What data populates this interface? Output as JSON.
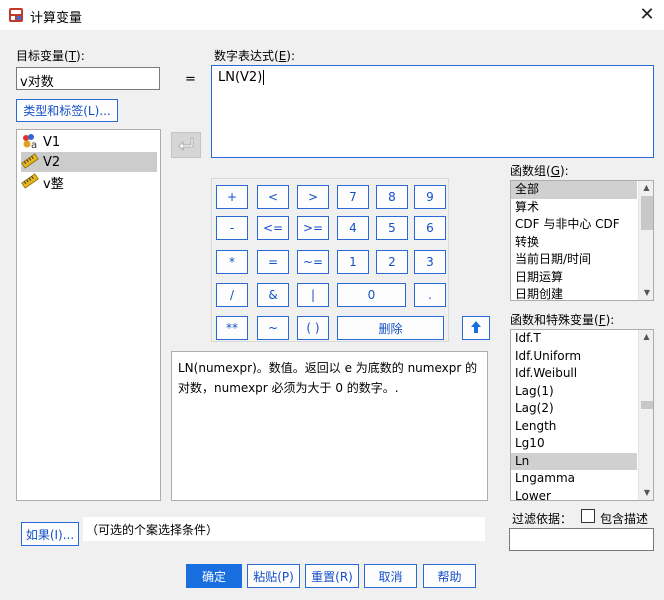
{
  "window": {
    "title": "计算变量",
    "close": "✕"
  },
  "target": {
    "label": "目标变量(",
    "label_key": "T",
    "label_end": "):",
    "value": "v对数",
    "type_label_button": "类型和标签(L)..."
  },
  "equals": "=",
  "expression": {
    "label": "数字表达式(",
    "label_key": "E",
    "label_end": "):",
    "value": "LN(V2)"
  },
  "variables": [
    {
      "name": "V1",
      "icon": "nominal-var-icon"
    },
    {
      "name": "V2",
      "icon": "scale-var-icon",
      "selected": true
    },
    {
      "name": "v整",
      "icon": "scale-var-icon"
    }
  ],
  "keypad": {
    "rows": [
      [
        "+",
        "<",
        ">",
        "7",
        "8",
        "9"
      ],
      [
        "-",
        "<=",
        ">=",
        "4",
        "5",
        "6"
      ],
      [
        "*",
        "=",
        "~=",
        "1",
        "2",
        "3"
      ],
      [
        "/",
        "&",
        "|",
        "0",
        "."
      ],
      [
        "**",
        "~",
        "( )",
        "删除"
      ]
    ]
  },
  "description": "LN(numexpr)。数值。返回以 e 为底数的 numexpr 的对数，numexpr 必须为大于 0 的数字。.",
  "function_group": {
    "label": "函数组(",
    "label_key": "G",
    "label_end": "):",
    "items": [
      "全部",
      "算术",
      "CDF 与非中心 CDF",
      "转换",
      "当前日期/时间",
      "日期运算",
      "日期创建"
    ],
    "selected": 0
  },
  "functions": {
    "label": "函数和特殊变量(",
    "label_key": "F",
    "label_end": "):",
    "items": [
      "Idf.T",
      "Idf.Uniform",
      "Idf.Weibull",
      "Lag(1)",
      "Lag(2)",
      "Length",
      "Lg10",
      "Ln",
      "Lngamma",
      "Lower"
    ],
    "selected": 7
  },
  "filter": {
    "label": "过滤依据：",
    "include_desc": "包含描述"
  },
  "if_button": "如果(I)...",
  "if_condition": "（可选的个案选择条件）",
  "buttons": {
    "ok": "确定",
    "paste": "粘贴(P)",
    "reset": "重置(R)",
    "cancel": "取消",
    "help": "帮助"
  },
  "colors": {
    "accent": "#1a6fe0",
    "border_blue": "#2a6ad8"
  }
}
